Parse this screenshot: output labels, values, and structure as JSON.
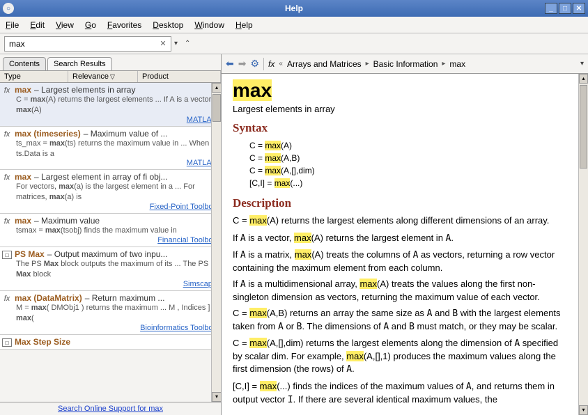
{
  "window": {
    "title": "Help"
  },
  "menu": {
    "file": "File",
    "edit": "Edit",
    "view": "View",
    "go": "Go",
    "favorites": "Favorites",
    "desktop": "Desktop",
    "window": "Window",
    "help": "Help"
  },
  "search": {
    "value": "max"
  },
  "tabs": {
    "contents": "Contents",
    "results": "Search Results"
  },
  "headers": {
    "type": "Type",
    "relevance": "Relevance",
    "product": "Product"
  },
  "results": [
    {
      "icon": "fx",
      "name": "max",
      "desc": "– Largest elements in array",
      "snippet": "C = max(A) returns the largest elements ... If A is a vector, max(A)",
      "product": "MATLAB"
    },
    {
      "icon": "fx",
      "name": "max (timeseries)",
      "desc": "– Maximum value of ...",
      "snippet": "ts_max = max(ts) returns the maximum value in ... When ts.Data is a",
      "product": "MATLAB"
    },
    {
      "icon": "fx",
      "name": "max",
      "desc": "– Largest element in array of fi obj...",
      "snippet": "For vectors, max(a) is the largest element in a ... For matrices, max(a) is",
      "product": "Fixed-Point Toolbox"
    },
    {
      "icon": "fx",
      "name": "max",
      "desc": "– Maximum value",
      "snippet": "tsmax = max(tsobj) finds the maximum value in",
      "product": "Financial Toolbox"
    },
    {
      "icon": "blk",
      "name": "PS Max",
      "desc": "– Output maximum of two inpu...",
      "snippet": "The PS Max block outputs the maximum of its ... The PS Max block",
      "product": "Simscape"
    },
    {
      "icon": "fx",
      "name": "max (DataMatrix)",
      "desc": "– Return maximum ...",
      "snippet": "M = max( DMObj1 ) returns the maximum ... M , Indices ] = max(",
      "product": "Bioinformatics Toolbox"
    },
    {
      "icon": "blk",
      "name": "Max Step Size",
      "desc": "",
      "snippet": "",
      "product": ""
    }
  ],
  "footer": {
    "link": "Search Online Support for max"
  },
  "breadcrumb": {
    "root_icon": "fx",
    "a": "Arrays and Matrices",
    "b": "Basic Information",
    "c": "max"
  },
  "doc": {
    "title": "max",
    "subtitle": "Largest elements in array",
    "syntax_h": "Syntax",
    "syntax1": "C = ",
    "syntax1b": "(A)",
    "syntax2": "C = ",
    "syntax2b": "(A,B)",
    "syntax3": "C = ",
    "syntax3b": "(A,[],dim)",
    "syntax4": "[C,I] = ",
    "syntax4b": "(...)",
    "desc_h": "Description",
    "p1a": "C = ",
    "p1b": "(A)",
    "p1c": " returns the largest elements along different dimensions of an array.",
    "p2a": "If ",
    "p2b": "A",
    "p2c": " is a vector, ",
    "p2d": "(A)",
    "p2e": " returns the largest element in ",
    "p2f": "A",
    "p2g": ".",
    "p3a": "If ",
    "p3b": "A",
    "p3c": " is a matrix, ",
    "p3d": "(A)",
    "p3e": " treats the columns of ",
    "p3f": "A",
    "p3g": " as vectors, returning a row vector containing the maximum element from each column.",
    "p4a": "If ",
    "p4b": "A",
    "p4c": " is a multidimensional array, ",
    "p4d": "(A)",
    "p4e": " treats the values along the first non-singleton dimension as vectors, returning the maximum value of each vector.",
    "p5a": "C = ",
    "p5b": "(A,B)",
    "p5c": " returns an array the same size as ",
    "p5d": "A",
    "p5e": " and ",
    "p5f": "B",
    "p5g": " with the largest elements taken from ",
    "p5h": "A",
    "p5i": " or ",
    "p5j": "B",
    "p5k": ". The dimensions of ",
    "p5l": "A",
    "p5m": " and ",
    "p5n": "B",
    "p5o": " must match, or they may be scalar.",
    "p6a": "C = ",
    "p6b": "(A,[],dim)",
    "p6c": " returns the largest elements along the dimension of ",
    "p6d": "A",
    "p6e": " specified by scalar dim. For example, ",
    "p6f": "(A,[],1)",
    "p6g": " produces the maximum values along the first dimension (the rows) of ",
    "p6h": "A",
    "p6i": ".",
    "p7a": "[C,I] = ",
    "p7b": "(...)",
    "p7c": " finds the indices of the maximum values of ",
    "p7d": "A",
    "p7e": ", and returns them in output vector ",
    "p7f": "I",
    "p7g": ". If there are several identical maximum values, the",
    "hl": "max"
  }
}
